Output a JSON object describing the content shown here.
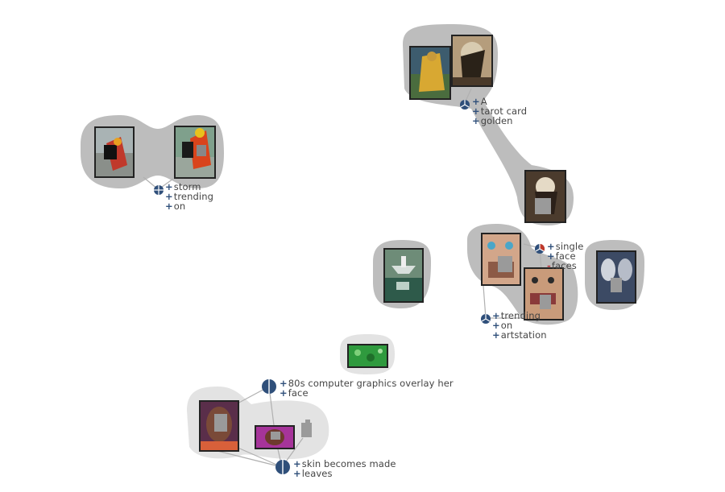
{
  "colors": {
    "hull_dark": "#bdbdbd",
    "hull_light": "#e3e3e3",
    "edge": "#b0b0b0",
    "glyph_blue": "#2f4f7a",
    "glyph_red": "#c0392b",
    "sign_blue": "#2f4f7a",
    "sign_red": "#b8323a",
    "text": "#444444"
  },
  "clusters": [
    {
      "id": "storm-cluster",
      "glyph": "plus-circle-icon",
      "keywords": [
        {
          "sign": "+",
          "text": "storm"
        },
        {
          "sign": "+",
          "text": "trending"
        },
        {
          "sign": "+",
          "text": "on"
        }
      ]
    },
    {
      "id": "tarot-cluster",
      "glyph": "tri-split-circle-icon",
      "keywords": [
        {
          "sign": "+",
          "text": "A"
        },
        {
          "sign": "+",
          "text": "tarot card"
        },
        {
          "sign": "+",
          "text": "golden"
        }
      ]
    },
    {
      "id": "face-cluster",
      "glyph": "tri-split-circle-red-icon",
      "keywords": [
        {
          "sign": "+",
          "text": "single"
        },
        {
          "sign": "+",
          "text": "face"
        },
        {
          "sign": "-",
          "text": "faces"
        }
      ]
    },
    {
      "id": "artstation-cluster",
      "glyph": "tri-split-circle-icon",
      "keywords": [
        {
          "sign": "+",
          "text": "trending"
        },
        {
          "sign": "+",
          "text": "on"
        },
        {
          "sign": "+",
          "text": "artstation"
        }
      ]
    },
    {
      "id": "overlay-cluster",
      "glyph": "half-circle-icon",
      "keywords": [
        {
          "sign": "+",
          "text": "80s computer graphics overlay her"
        },
        {
          "sign": "+",
          "text": "face"
        }
      ]
    },
    {
      "id": "leaves-cluster",
      "glyph": "half-circle-icon",
      "keywords": [
        {
          "sign": "+",
          "text": "skin becomes made"
        },
        {
          "sign": "+",
          "text": "leaves"
        }
      ]
    }
  ]
}
